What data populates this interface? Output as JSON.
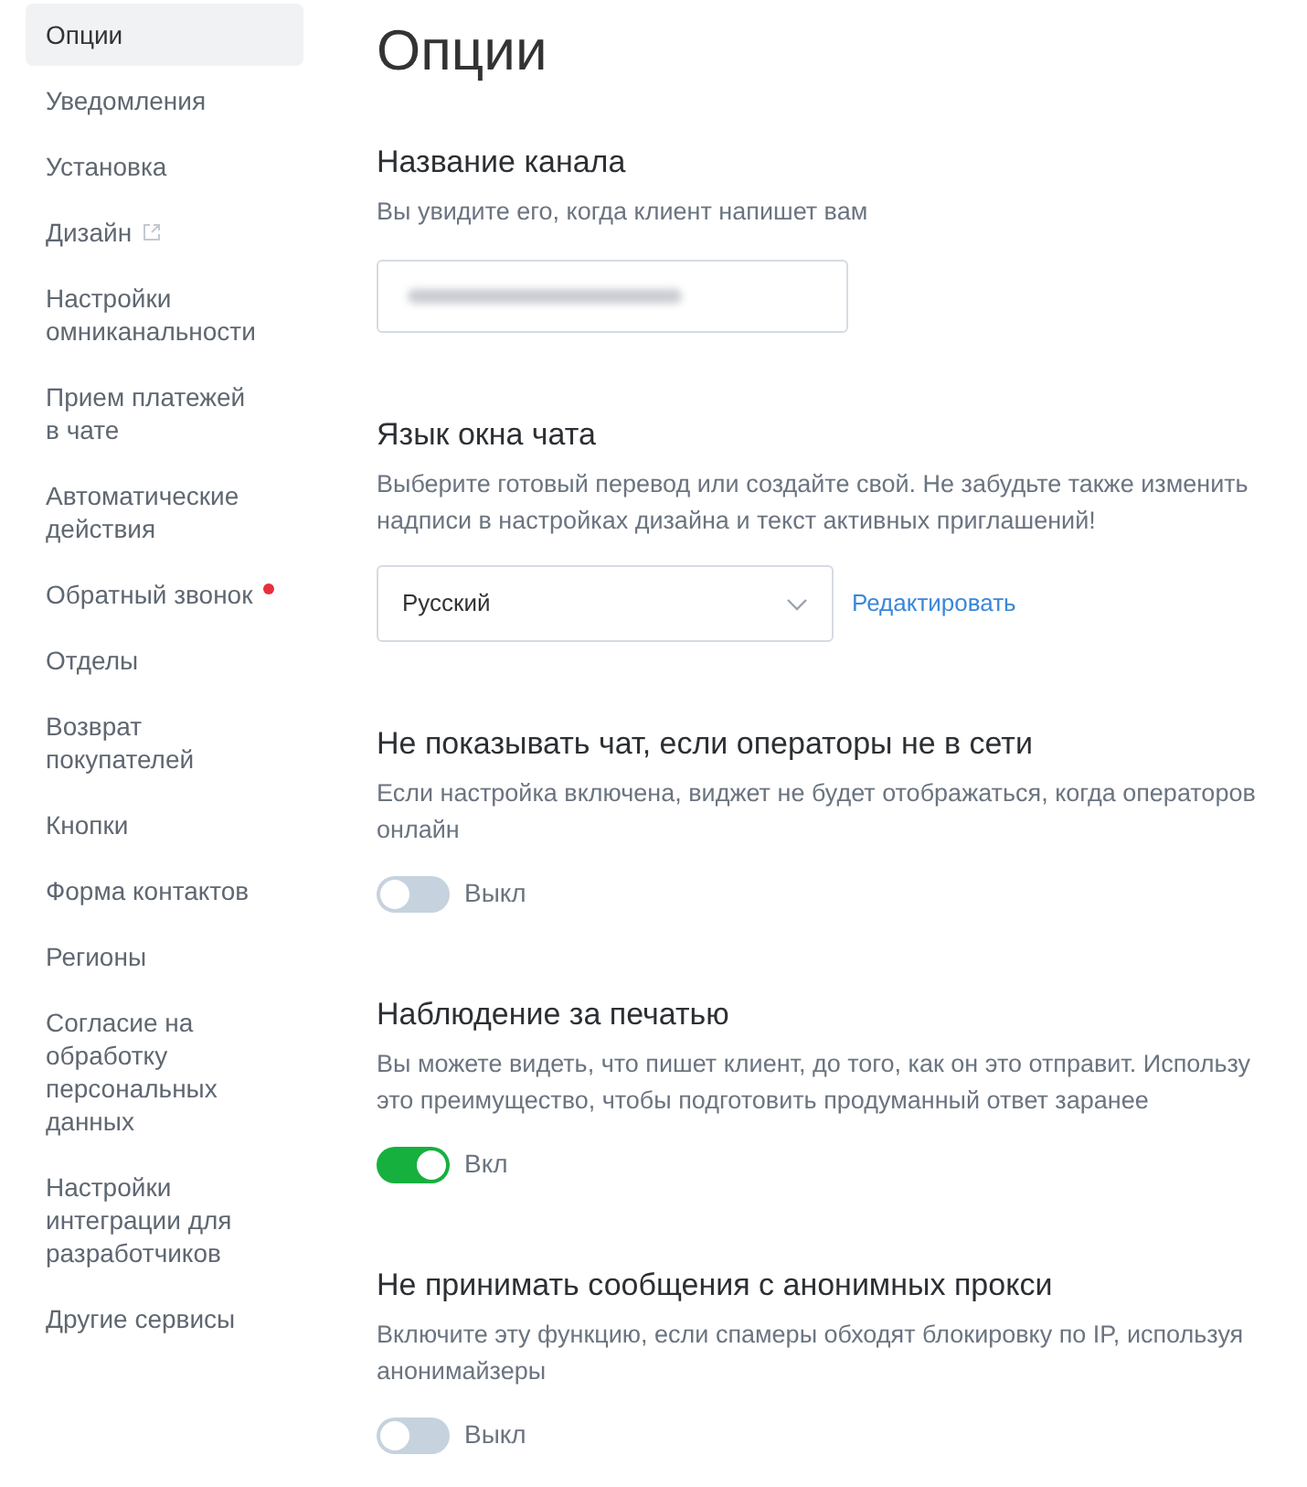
{
  "sidebar": {
    "items": [
      {
        "lines": [
          "Опции"
        ],
        "selected": true,
        "external": false,
        "notification": false
      },
      {
        "lines": [
          "Уведомления"
        ],
        "selected": false,
        "external": false,
        "notification": false
      },
      {
        "lines": [
          "Установка"
        ],
        "selected": false,
        "external": false,
        "notification": false
      },
      {
        "lines": [
          "Дизайн"
        ],
        "selected": false,
        "external": true,
        "notification": false
      },
      {
        "lines": [
          "Настройки",
          "омниканальности"
        ],
        "selected": false,
        "external": false,
        "notification": false
      },
      {
        "lines": [
          "Прием платежей",
          "в чате"
        ],
        "selected": false,
        "external": false,
        "notification": false
      },
      {
        "lines": [
          "Автоматические",
          "действия"
        ],
        "selected": false,
        "external": false,
        "notification": false
      },
      {
        "lines": [
          "Обратный звонок"
        ],
        "selected": false,
        "external": false,
        "notification": true
      },
      {
        "lines": [
          "Отделы"
        ],
        "selected": false,
        "external": false,
        "notification": false
      },
      {
        "lines": [
          "Возврат",
          "покупателей"
        ],
        "selected": false,
        "external": false,
        "notification": false
      },
      {
        "lines": [
          "Кнопки"
        ],
        "selected": false,
        "external": false,
        "notification": false
      },
      {
        "lines": [
          "Форма контактов"
        ],
        "selected": false,
        "external": false,
        "notification": false
      },
      {
        "lines": [
          "Регионы"
        ],
        "selected": false,
        "external": false,
        "notification": false
      },
      {
        "lines": [
          "Согласие на",
          "обработку",
          "персональных",
          "данных"
        ],
        "selected": false,
        "external": false,
        "notification": false
      },
      {
        "lines": [
          "Настройки",
          "интеграции для",
          "разработчиков"
        ],
        "selected": false,
        "external": false,
        "notification": false
      },
      {
        "lines": [
          "Другие сервисы"
        ],
        "selected": false,
        "external": false,
        "notification": false
      }
    ]
  },
  "page_title": "Опции",
  "sections": [
    {
      "kind": "text_field",
      "title": "Название канала",
      "description": [
        "Вы увидите его, когда клиент напишет вам"
      ]
    },
    {
      "kind": "select",
      "title": "Язык окна чата",
      "description": [
        "Выберите готовый перевод или создайте свой. Не забудьте также изменить",
        "надписи в настройках дизайна и текст активных приглашений!"
      ],
      "value": "Русский",
      "link": "Редактировать"
    },
    {
      "kind": "toggle",
      "title": "Не показывать чат, если операторы не в сети",
      "description": [
        "Если настройка включена, виджет не будет отображаться, когда операторов",
        "онлайн"
      ],
      "on": false,
      "state_label": "Выкл"
    },
    {
      "kind": "toggle",
      "title": "Наблюдение за печатью",
      "description": [
        "Вы можете видеть, что пишет клиент, до того, как он это отправит. Использу",
        "это преимущество, чтобы подготовить продуманный ответ заранее"
      ],
      "on": true,
      "state_label": "Вкл"
    },
    {
      "kind": "toggle",
      "title": "Не принимать сообщения с анонимных прокси",
      "description": [
        "Включите эту функцию, если спамеры обходят блокировку по IP, используя",
        "анонимайзеры"
      ],
      "on": false,
      "state_label": "Выкл"
    }
  ]
}
